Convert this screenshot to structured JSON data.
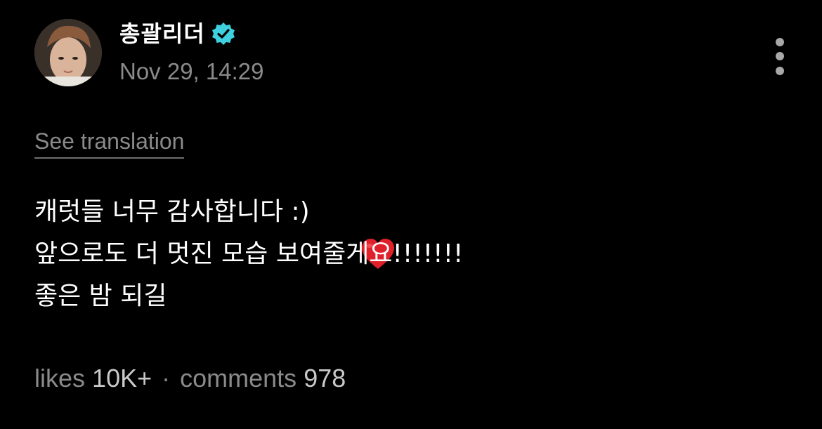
{
  "post": {
    "username": "총괄리더",
    "verified_color": "#3fd0e0",
    "timestamp": "Nov 29, 14:29",
    "see_translation": "See translation",
    "lines": [
      "캐럿들 너무 감사합니다 :)",
      "앞으로도 더 멋진 모습 보여줄게요!!!!!!!",
      "좋은 밤 되길"
    ],
    "heart_emoji": "❤️",
    "stats": {
      "likes_label": "likes",
      "likes_count": "10K+",
      "separator": "·",
      "comments_label": "comments",
      "comments_count": "978"
    }
  },
  "icons": {
    "avatar": "profile-photo",
    "verified": "verified-badge-icon",
    "more": "more-vertical-icon",
    "heart": "red-heart-emoji"
  }
}
